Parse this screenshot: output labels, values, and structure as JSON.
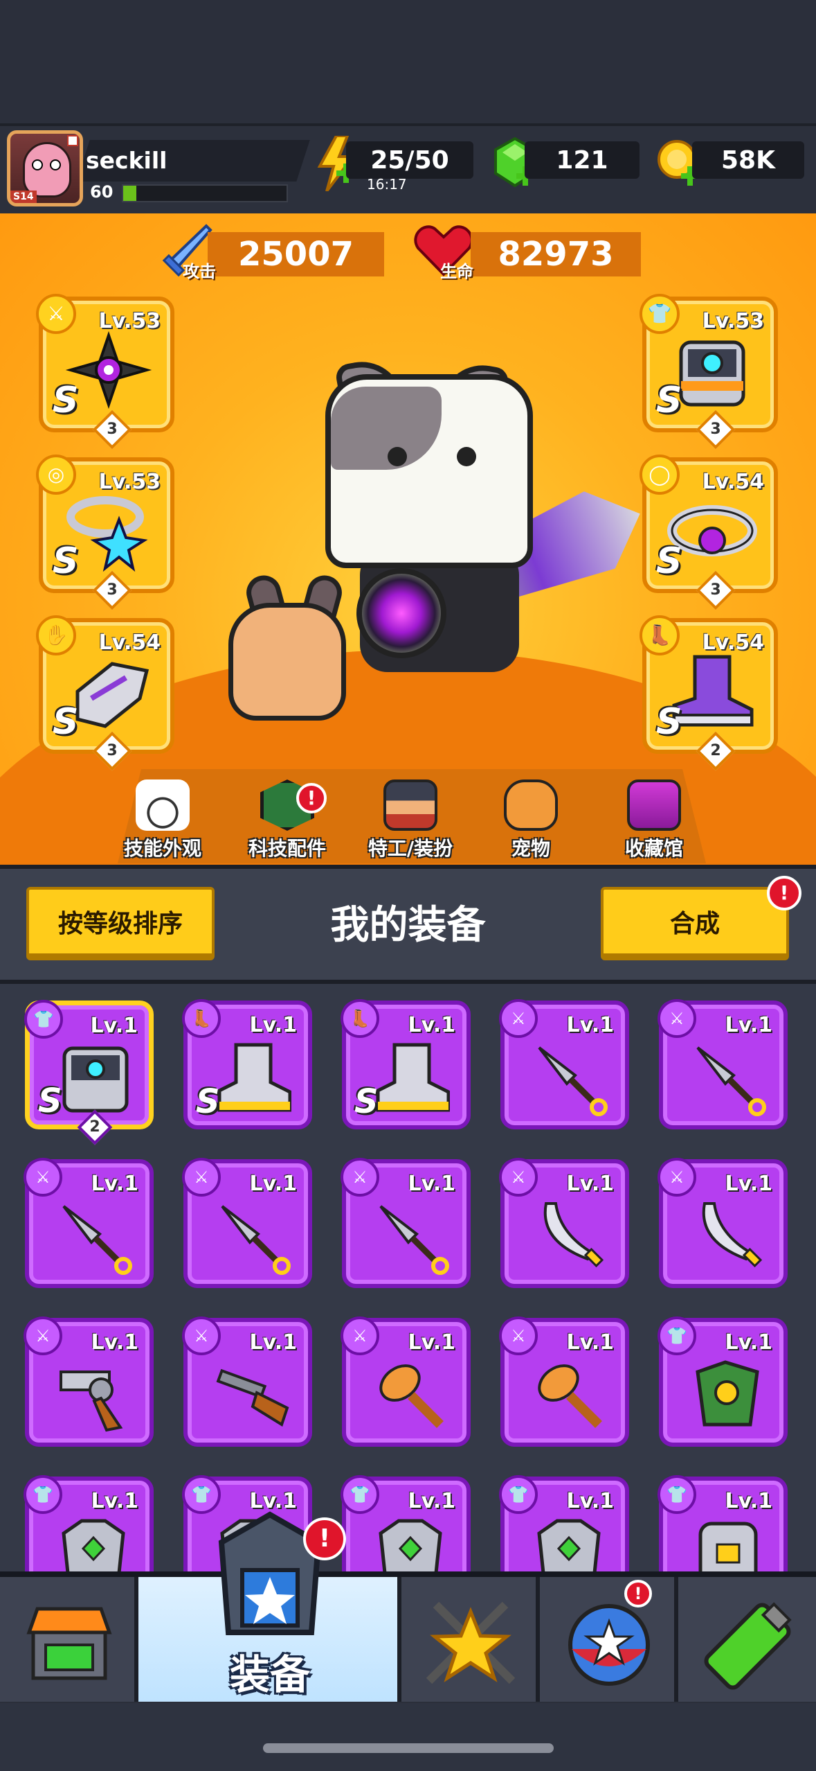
{
  "player": {
    "name": "seckill",
    "level": "60",
    "season_tag": "S14",
    "xp_fraction": 0.08
  },
  "resources": {
    "energy": "25/50",
    "energy_timer": "16:17",
    "gems": "121",
    "coins": "58K"
  },
  "stats": {
    "attack_label": "攻击",
    "attack_value": "25007",
    "hp_label": "生命",
    "hp_value": "82973"
  },
  "equipped": {
    "left": [
      {
        "level": "Lv.53",
        "grade": "S",
        "stars": "3",
        "type": "weapon"
      },
      {
        "level": "Lv.53",
        "grade": "S",
        "stars": "3",
        "type": "necklace"
      },
      {
        "level": "Lv.54",
        "grade": "S",
        "stars": "3",
        "type": "gloves"
      }
    ],
    "right": [
      {
        "level": "Lv.53",
        "grade": "S",
        "stars": "3",
        "type": "armor"
      },
      {
        "level": "Lv.54",
        "grade": "S",
        "stars": "3",
        "type": "belt"
      },
      {
        "level": "Lv.54",
        "grade": "S",
        "stars": "2",
        "type": "boots"
      }
    ]
  },
  "menu": [
    {
      "label": "技能外观"
    },
    {
      "label": "科技配件"
    },
    {
      "label": "特工/装扮"
    },
    {
      "label": "宠物"
    },
    {
      "label": "收藏馆"
    }
  ],
  "section": {
    "sort_button": "按等级排序",
    "title": "我的装备",
    "merge_button": "合成"
  },
  "inventory": [
    {
      "level": "Lv.1",
      "grade": "S",
      "stars": "2",
      "type": "armor",
      "icon": "armor-icon"
    },
    {
      "level": "Lv.1",
      "grade": "S",
      "type": "boots",
      "icon": "boots-icon"
    },
    {
      "level": "Lv.1",
      "grade": "S",
      "type": "boots",
      "icon": "boots-icon"
    },
    {
      "level": "Lv.1",
      "type": "weapon",
      "icon": "kunai-icon"
    },
    {
      "level": "Lv.1",
      "type": "weapon",
      "icon": "kunai-icon"
    },
    {
      "level": "Lv.1",
      "type": "weapon",
      "icon": "kunai-icon"
    },
    {
      "level": "Lv.1",
      "type": "weapon",
      "icon": "kunai-icon"
    },
    {
      "level": "Lv.1",
      "type": "weapon",
      "icon": "kunai-icon"
    },
    {
      "level": "Lv.1",
      "type": "weapon",
      "icon": "scimitar-icon"
    },
    {
      "level": "Lv.1",
      "type": "weapon",
      "icon": "scimitar-icon"
    },
    {
      "level": "Lv.1",
      "type": "weapon",
      "icon": "revolver-icon"
    },
    {
      "level": "Lv.1",
      "type": "weapon",
      "icon": "shotgun-icon"
    },
    {
      "level": "Lv.1",
      "type": "weapon",
      "icon": "club-icon"
    },
    {
      "level": "Lv.1",
      "type": "weapon",
      "icon": "club-icon"
    },
    {
      "level": "Lv.1",
      "type": "armor",
      "icon": "leaf-armor-icon"
    },
    {
      "level": "Lv.1",
      "type": "armor",
      "icon": "plate-armor-icon"
    },
    {
      "level": "Lv.1",
      "type": "armor",
      "icon": "plate-armor-icon"
    },
    {
      "level": "Lv.1",
      "type": "armor",
      "icon": "plate-armor-icon"
    },
    {
      "level": "Lv.1",
      "type": "armor",
      "icon": "plate-armor-icon"
    },
    {
      "level": "Lv.1",
      "type": "armor",
      "icon": "robot-armor-icon"
    }
  ],
  "tabs": [
    {
      "icon": "shop-icon"
    },
    {
      "icon": "equipment-icon",
      "label": "装备",
      "active": true
    },
    {
      "icon": "battle-icon"
    },
    {
      "icon": "talent-icon"
    },
    {
      "icon": "evolve-icon"
    }
  ],
  "colors": {
    "legendary_gold": "#ffc21a",
    "epic_purple": "#b53ef0",
    "stage_orange": "#ff9a10",
    "alert_red": "#e0152b"
  }
}
